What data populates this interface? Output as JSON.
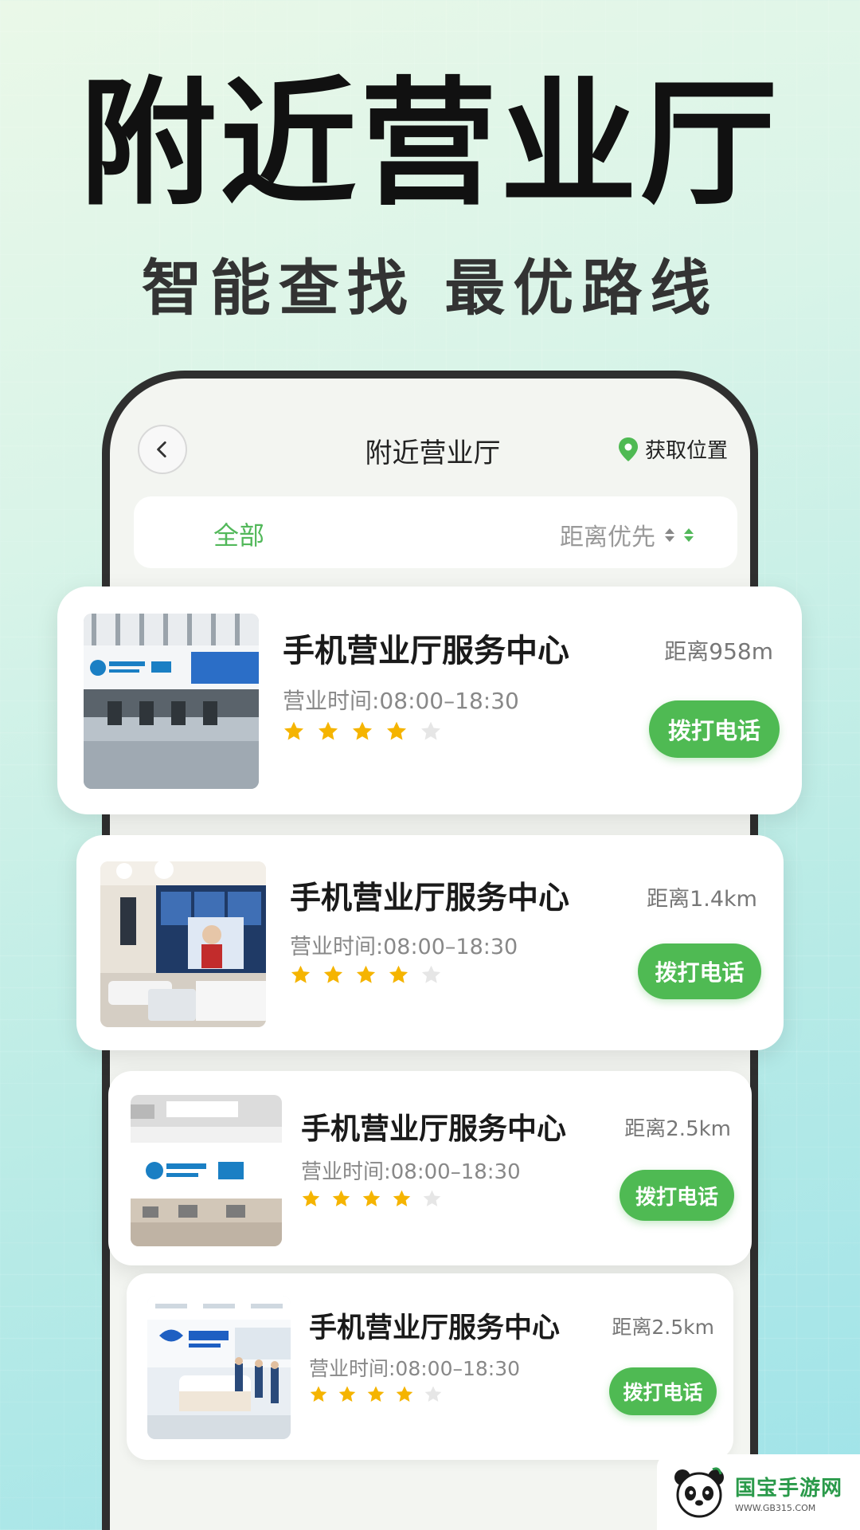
{
  "banner": {
    "headline": "附近营业厅",
    "subline": "智能查找 最优路线"
  },
  "header": {
    "title": "附近营业厅",
    "location_label": "获取位置"
  },
  "filter": {
    "all_label": "全部",
    "sort_label": "距离优先"
  },
  "colors": {
    "accent": "#4fba53",
    "star_on": "#f5b400",
    "star_off": "#e6e6e6"
  },
  "icons": {
    "back": "chevron-left-icon",
    "location": "location-pin-icon",
    "sort": "sort-arrows-icon",
    "star": "star-icon"
  },
  "stores": [
    {
      "name": "手机营业厅服务中心",
      "hours": "营业时间:08:00–18:30",
      "distance": "距离958m",
      "rating": 4,
      "call_label": "拨打电话"
    },
    {
      "name": "手机营业厅服务中心",
      "hours": "营业时间:08:00–18:30",
      "distance": "距离1.4km",
      "rating": 4,
      "call_label": "拨打电话"
    },
    {
      "name": "手机营业厅服务中心",
      "hours": "营业时间:08:00–18:30",
      "distance": "距离2.5km",
      "rating": 4,
      "call_label": "拨打电话"
    },
    {
      "name": "手机营业厅服务中心",
      "hours": "营业时间:08:00–18:30",
      "distance": "距离2.5km",
      "rating": 4,
      "call_label": "拨打电话"
    }
  ],
  "watermark": {
    "title": "国宝手游网",
    "url": "WWW.GB315.COM"
  }
}
